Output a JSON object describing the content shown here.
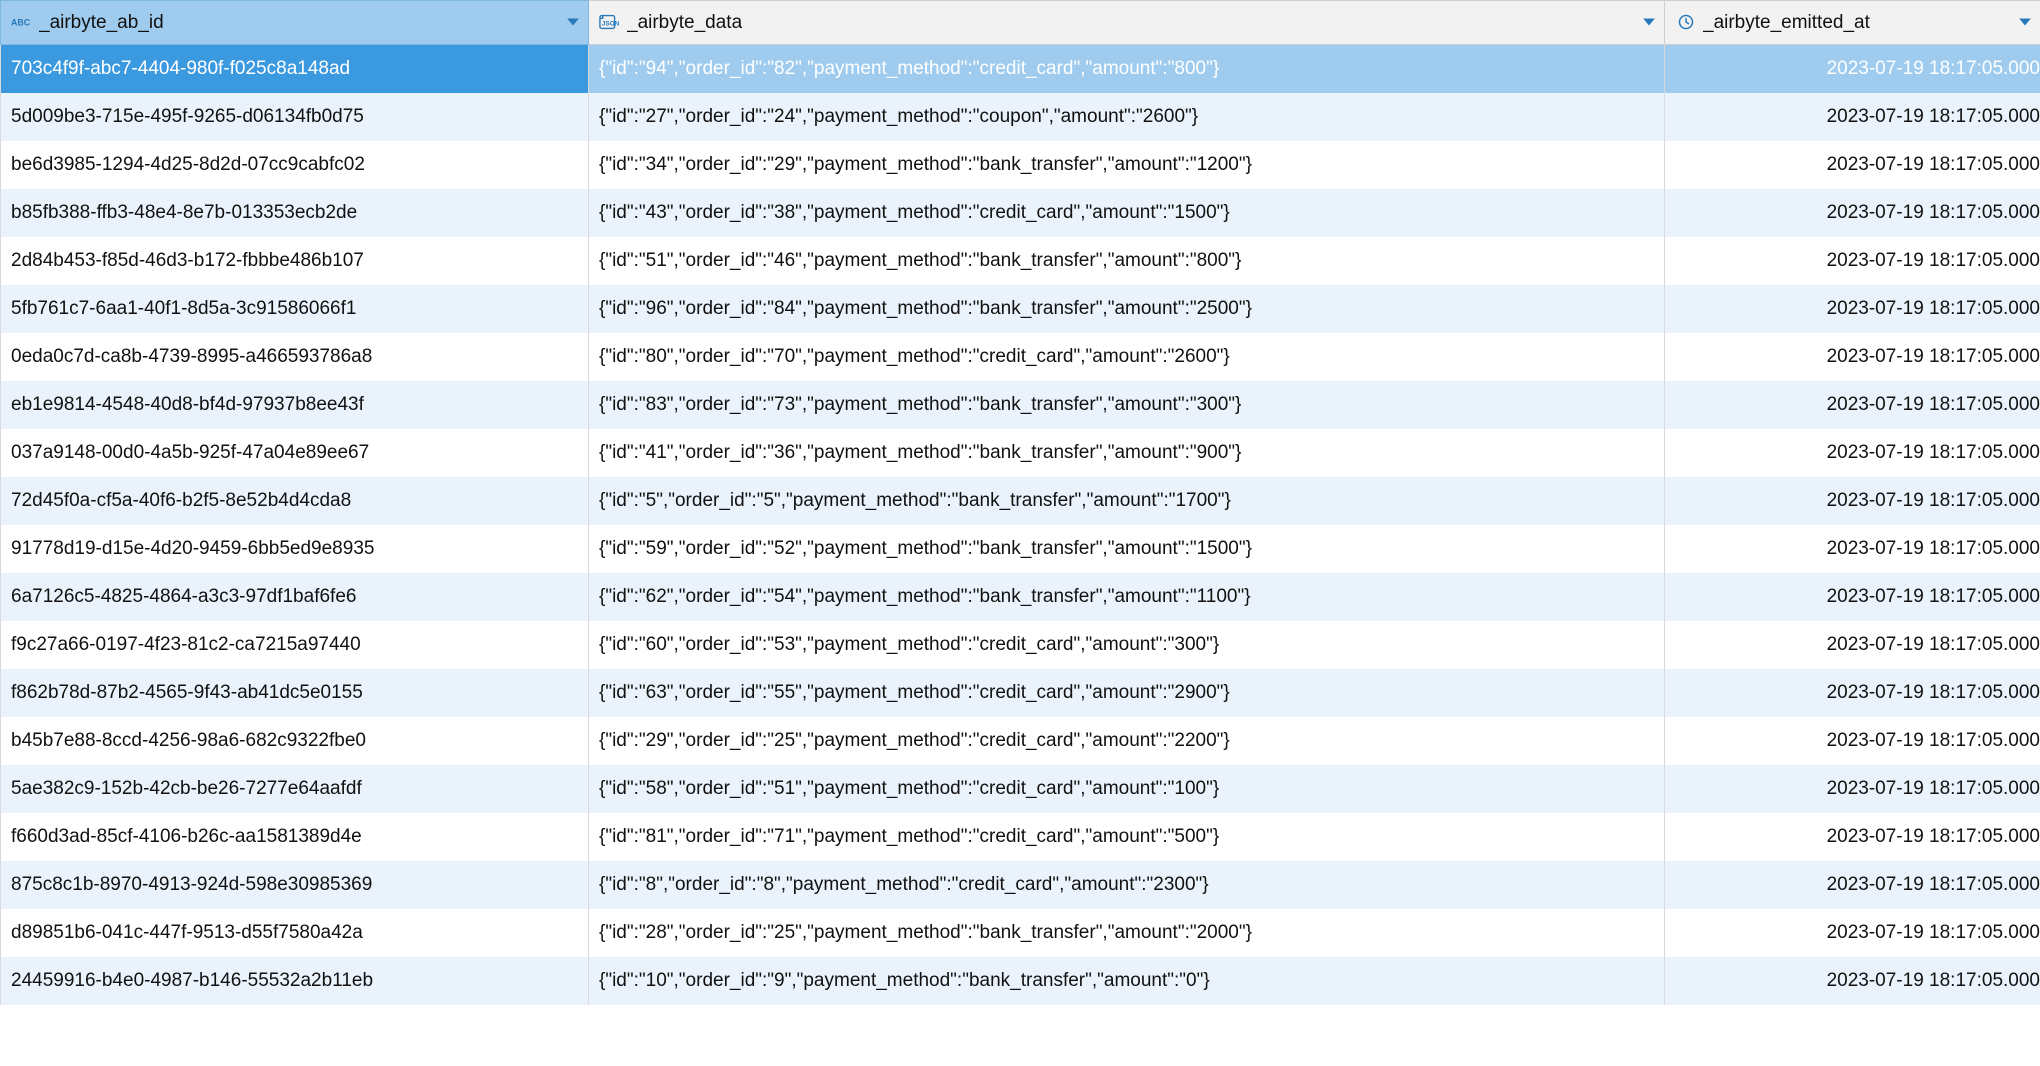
{
  "columns": [
    {
      "name": "_airbyte_ab_id",
      "type": "text",
      "sorted": true
    },
    {
      "name": "_airbyte_data",
      "type": "json",
      "sorted": false
    },
    {
      "name": "_airbyte_emitted_at",
      "type": "timestamp",
      "sorted": false
    }
  ],
  "rows": [
    {
      "id": "703c4f9f-abc7-4404-980f-f025c8a148ad",
      "data": "{\"id\":\"94\",\"order_id\":\"82\",\"payment_method\":\"credit_card\",\"amount\":\"800\"}",
      "ts": "2023-07-19 18:17:05.000",
      "selected": true
    },
    {
      "id": "5d009be3-715e-495f-9265-d06134fb0d75",
      "data": "{\"id\":\"27\",\"order_id\":\"24\",\"payment_method\":\"coupon\",\"amount\":\"2600\"}",
      "ts": "2023-07-19 18:17:05.000"
    },
    {
      "id": "be6d3985-1294-4d25-8d2d-07cc9cabfc02",
      "data": "{\"id\":\"34\",\"order_id\":\"29\",\"payment_method\":\"bank_transfer\",\"amount\":\"1200\"}",
      "ts": "2023-07-19 18:17:05.000"
    },
    {
      "id": "b85fb388-ffb3-48e4-8e7b-013353ecb2de",
      "data": "{\"id\":\"43\",\"order_id\":\"38\",\"payment_method\":\"credit_card\",\"amount\":\"1500\"}",
      "ts": "2023-07-19 18:17:05.000"
    },
    {
      "id": "2d84b453-f85d-46d3-b172-fbbbe486b107",
      "data": "{\"id\":\"51\",\"order_id\":\"46\",\"payment_method\":\"bank_transfer\",\"amount\":\"800\"}",
      "ts": "2023-07-19 18:17:05.000"
    },
    {
      "id": "5fb761c7-6aa1-40f1-8d5a-3c91586066f1",
      "data": "{\"id\":\"96\",\"order_id\":\"84\",\"payment_method\":\"bank_transfer\",\"amount\":\"2500\"}",
      "ts": "2023-07-19 18:17:05.000"
    },
    {
      "id": "0eda0c7d-ca8b-4739-8995-a466593786a8",
      "data": "{\"id\":\"80\",\"order_id\":\"70\",\"payment_method\":\"credit_card\",\"amount\":\"2600\"}",
      "ts": "2023-07-19 18:17:05.000"
    },
    {
      "id": "eb1e9814-4548-40d8-bf4d-97937b8ee43f",
      "data": "{\"id\":\"83\",\"order_id\":\"73\",\"payment_method\":\"bank_transfer\",\"amount\":\"300\"}",
      "ts": "2023-07-19 18:17:05.000"
    },
    {
      "id": "037a9148-00d0-4a5b-925f-47a04e89ee67",
      "data": "{\"id\":\"41\",\"order_id\":\"36\",\"payment_method\":\"bank_transfer\",\"amount\":\"900\"}",
      "ts": "2023-07-19 18:17:05.000"
    },
    {
      "id": "72d45f0a-cf5a-40f6-b2f5-8e52b4d4cda8",
      "data": "{\"id\":\"5\",\"order_id\":\"5\",\"payment_method\":\"bank_transfer\",\"amount\":\"1700\"}",
      "ts": "2023-07-19 18:17:05.000"
    },
    {
      "id": "91778d19-d15e-4d20-9459-6bb5ed9e8935",
      "data": "{\"id\":\"59\",\"order_id\":\"52\",\"payment_method\":\"bank_transfer\",\"amount\":\"1500\"}",
      "ts": "2023-07-19 18:17:05.000"
    },
    {
      "id": "6a7126c5-4825-4864-a3c3-97df1baf6fe6",
      "data": "{\"id\":\"62\",\"order_id\":\"54\",\"payment_method\":\"bank_transfer\",\"amount\":\"1100\"}",
      "ts": "2023-07-19 18:17:05.000"
    },
    {
      "id": "f9c27a66-0197-4f23-81c2-ca7215a97440",
      "data": "{\"id\":\"60\",\"order_id\":\"53\",\"payment_method\":\"credit_card\",\"amount\":\"300\"}",
      "ts": "2023-07-19 18:17:05.000"
    },
    {
      "id": "f862b78d-87b2-4565-9f43-ab41dc5e0155",
      "data": "{\"id\":\"63\",\"order_id\":\"55\",\"payment_method\":\"credit_card\",\"amount\":\"2900\"}",
      "ts": "2023-07-19 18:17:05.000"
    },
    {
      "id": "b45b7e88-8ccd-4256-98a6-682c9322fbe0",
      "data": "{\"id\":\"29\",\"order_id\":\"25\",\"payment_method\":\"credit_card\",\"amount\":\"2200\"}",
      "ts": "2023-07-19 18:17:05.000"
    },
    {
      "id": "5ae382c9-152b-42cb-be26-7277e64aafdf",
      "data": "{\"id\":\"58\",\"order_id\":\"51\",\"payment_method\":\"credit_card\",\"amount\":\"100\"}",
      "ts": "2023-07-19 18:17:05.000"
    },
    {
      "id": "f660d3ad-85cf-4106-b26c-aa1581389d4e",
      "data": "{\"id\":\"81\",\"order_id\":\"71\",\"payment_method\":\"credit_card\",\"amount\":\"500\"}",
      "ts": "2023-07-19 18:17:05.000"
    },
    {
      "id": "875c8c1b-8970-4913-924d-598e30985369",
      "data": "{\"id\":\"8\",\"order_id\":\"8\",\"payment_method\":\"credit_card\",\"amount\":\"2300\"}",
      "ts": "2023-07-19 18:17:05.000"
    },
    {
      "id": "d89851b6-041c-447f-9513-d55f7580a42a",
      "data": "{\"id\":\"28\",\"order_id\":\"25\",\"payment_method\":\"bank_transfer\",\"amount\":\"2000\"}",
      "ts": "2023-07-19 18:17:05.000"
    },
    {
      "id": "24459916-b4e0-4987-b146-55532a2b11eb",
      "data": "{\"id\":\"10\",\"order_id\":\"9\",\"payment_method\":\"bank_transfer\",\"amount\":\"0\"}",
      "ts": "2023-07-19 18:17:05.000"
    }
  ]
}
